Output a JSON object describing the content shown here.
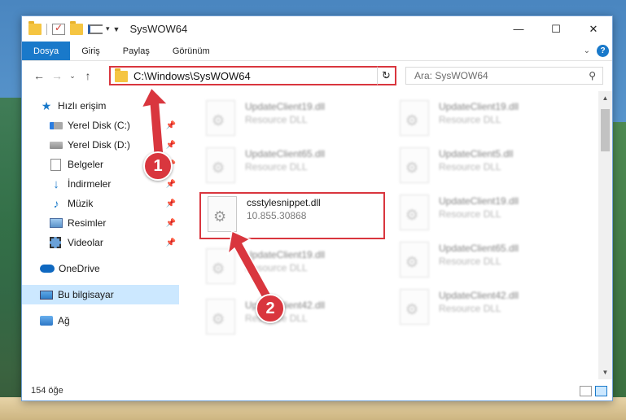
{
  "window": {
    "title": "SysWOW64",
    "minimize": "—",
    "maximize": "☐",
    "close": "✕"
  },
  "ribbon": {
    "tabs": [
      "Dosya",
      "Giriş",
      "Paylaş",
      "Görünüm"
    ],
    "help": "?"
  },
  "navigation": {
    "back": "←",
    "forward": "→",
    "recent": "⌄",
    "up": "↑",
    "address": "C:\\Windows\\SysWOW64",
    "address_dropdown": "⌄",
    "refresh": "↻",
    "search_placeholder": "Ara: SysWOW64",
    "search_glyph": "⚲"
  },
  "sidebar": {
    "items": [
      {
        "label": "Hızlı erişim",
        "icon": "star-icon"
      },
      {
        "label": "Yerel Disk (C:)",
        "icon": "drive-icon",
        "pinned": true
      },
      {
        "label": "Yerel Disk (D:)",
        "icon": "drive-icon",
        "pinned": true
      },
      {
        "label": "Belgeler",
        "icon": "documents-icon",
        "pinned": true
      },
      {
        "label": "İndirmeler",
        "icon": "downloads-icon",
        "pinned": true
      },
      {
        "label": "Müzik",
        "icon": "music-icon",
        "pinned": true
      },
      {
        "label": "Resimler",
        "icon": "pictures-icon",
        "pinned": true
      },
      {
        "label": "Videolar",
        "icon": "videos-icon",
        "pinned": true
      },
      {
        "label": "OneDrive",
        "icon": "onedrive-icon"
      },
      {
        "label": "Bu bilgisayar",
        "icon": "computer-icon",
        "selected": true
      },
      {
        "label": "Ağ",
        "icon": "network-icon"
      }
    ],
    "pin_glyph": "📌"
  },
  "files": [
    {
      "name": "UpdateClient19.dll",
      "sub": "Resource DLL"
    },
    {
      "name": "UpdateClient19.dll",
      "sub": "Resource DLL"
    },
    {
      "name": "UpdateClient65.dll",
      "sub": "Resource DLL"
    },
    {
      "name": "UpdateClient5.dll",
      "sub": "Resource DLL"
    },
    {
      "name": "csstylesnippet.dll",
      "sub": "10.855.30868",
      "highlighted": true
    },
    {
      "name": "UpdateClient19.dll",
      "sub": "Resource DLL"
    },
    {
      "name": "UpdateClient19.dll",
      "sub": "Resource DLL"
    },
    {
      "name": "UpdateClient65.dll",
      "sub": "Resource DLL"
    },
    {
      "name": "UpdateClient42.dll",
      "sub": "Resource DLL"
    },
    {
      "name": "UpdateClient42.dll",
      "sub": "Resource DLL"
    }
  ],
  "status": {
    "count": "154 öğe"
  },
  "callouts": [
    "1",
    "2"
  ],
  "colors": {
    "accent": "#1979ca",
    "highlight": "#d9363e",
    "selected": "#cce8ff"
  }
}
